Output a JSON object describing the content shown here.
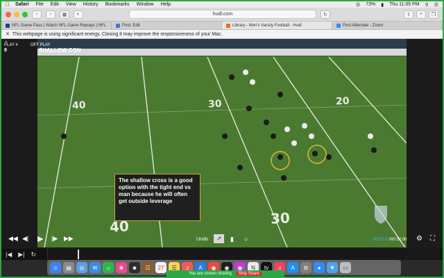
{
  "menubar": {
    "app": "Safari",
    "menus": [
      "File",
      "Edit",
      "View",
      "History",
      "Bookmarks",
      "Window",
      "Help"
    ],
    "battery": "73%",
    "clock": "Thu 11:05 PM"
  },
  "toolbar": {
    "url": "hudl.com"
  },
  "tabs": [
    {
      "label": "NFL Game Pass | Watch NFL Game Replays | NFL",
      "color": "#1e3f8a"
    },
    {
      "label": "Post: Edit",
      "color": "#3a7bd5"
    },
    {
      "label": "Library - Men's Varsity Football - Hudl",
      "color": "#f26c1c"
    },
    {
      "label": "Post Attendee - Zoom",
      "color": "#2d8cff"
    }
  ],
  "energy": {
    "message": "This webpage is using significant energy. Closing it may improve the responsiveness of your Mac."
  },
  "player": {
    "play_label": "PLAY #",
    "play_number": "8",
    "off_play_label": "OFF PLAY",
    "play_name": "SHALLOW CON",
    "caption": "The shallow cross is a good option with the tight end vs man because he will often get outside leverage",
    "undo_label": "Undo",
    "time_current": "00:02.67",
    "time_total": "/00:32.00",
    "yard_numbers": [
      "40",
      "30",
      "20",
      "40",
      "30"
    ]
  },
  "dock": {
    "share_text": "You are screen sharing",
    "stop_label": "Stop Share"
  }
}
